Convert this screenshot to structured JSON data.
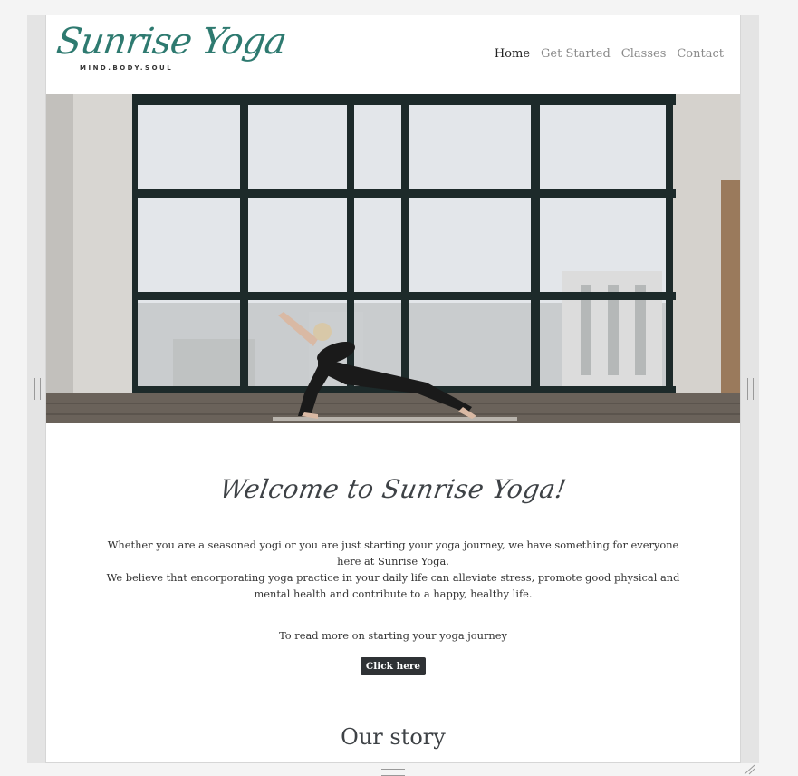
{
  "header": {
    "logo_title": "Sunrise Yoga",
    "logo_tagline": "MIND.BODY.SOUL",
    "nav": [
      {
        "label": "Home",
        "active": true
      },
      {
        "label": "Get Started",
        "active": false
      },
      {
        "label": "Classes",
        "active": false
      },
      {
        "label": "Contact",
        "active": false
      }
    ]
  },
  "main": {
    "welcome_heading": "Welcome to Sunrise Yoga!",
    "paragraph_1": "Whether you are a seasoned yogi or you are just starting your yoga journey, we have something for everyone here at Sunrise Yoga.",
    "paragraph_2": "We believe that encorporating yoga practice in your daily life can alleviate stress, promote good physical and mental health and contribute to a happy, healthy life.",
    "read_more_text": "To read more on starting your yoga journey",
    "button_label": "Click here",
    "story_heading": "Our story"
  },
  "colors": {
    "brand": "#2e7a70",
    "button_bg": "#2f3235",
    "heading": "#3e4246"
  }
}
